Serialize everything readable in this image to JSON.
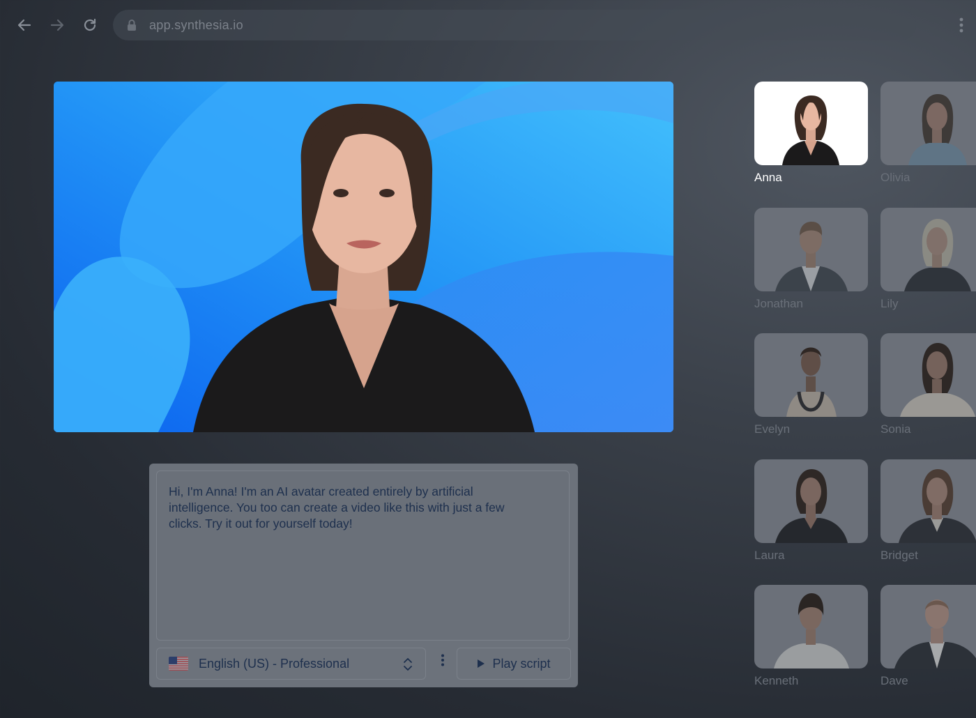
{
  "browser": {
    "url": "app.synthesia.io"
  },
  "script": {
    "text": "Hi, I'm Anna! I'm an AI avatar created entirely by artificial intelligence. You too can create a video like this with just a few clicks. Try it out for yourself today!"
  },
  "controls": {
    "language": "English (US) - Professional",
    "play_label": "Play script"
  },
  "avatars": [
    {
      "name": "Anna",
      "selected": true
    },
    {
      "name": "Olivia",
      "selected": false
    },
    {
      "name": "Jonathan",
      "selected": false
    },
    {
      "name": "Lily",
      "selected": false
    },
    {
      "name": "Evelyn",
      "selected": false
    },
    {
      "name": "Sonia",
      "selected": false
    },
    {
      "name": "Laura",
      "selected": false
    },
    {
      "name": "Bridget",
      "selected": false
    },
    {
      "name": "Kenneth",
      "selected": false
    },
    {
      "name": "Dave",
      "selected": false
    }
  ],
  "colors": {
    "preview_background": "#2a98f7",
    "panel": "#6c727b",
    "text_dark": "#1d2f4d"
  }
}
